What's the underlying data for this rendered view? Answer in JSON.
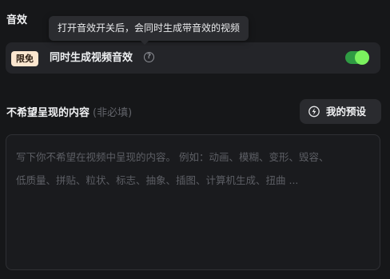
{
  "sound_section": {
    "title": "音效",
    "tooltip": "打开音效开关后，会同时生成带音效的视频"
  },
  "audio_toggle_row": {
    "badge": "限免",
    "label": "同时生成视频音效",
    "help_icon": "question-circle-icon",
    "toggle_on": true,
    "toggle_color": "#2f9b43",
    "knob_color": "#7bf25f"
  },
  "negative_prompt": {
    "title": "不希望呈现的内容",
    "optional_hint": "(非必填)",
    "preset_button": {
      "icon": "lightning-bolt-icon",
      "label": "我的预设"
    },
    "placeholder_line1": "写下你不希望在视频中呈现的内容。 例如：动画、模糊、变形、毁容、",
    "placeholder_line2": "低质量、拼贴、粒状、标志、抽象、插图、计算机生成、扭曲 ..."
  }
}
